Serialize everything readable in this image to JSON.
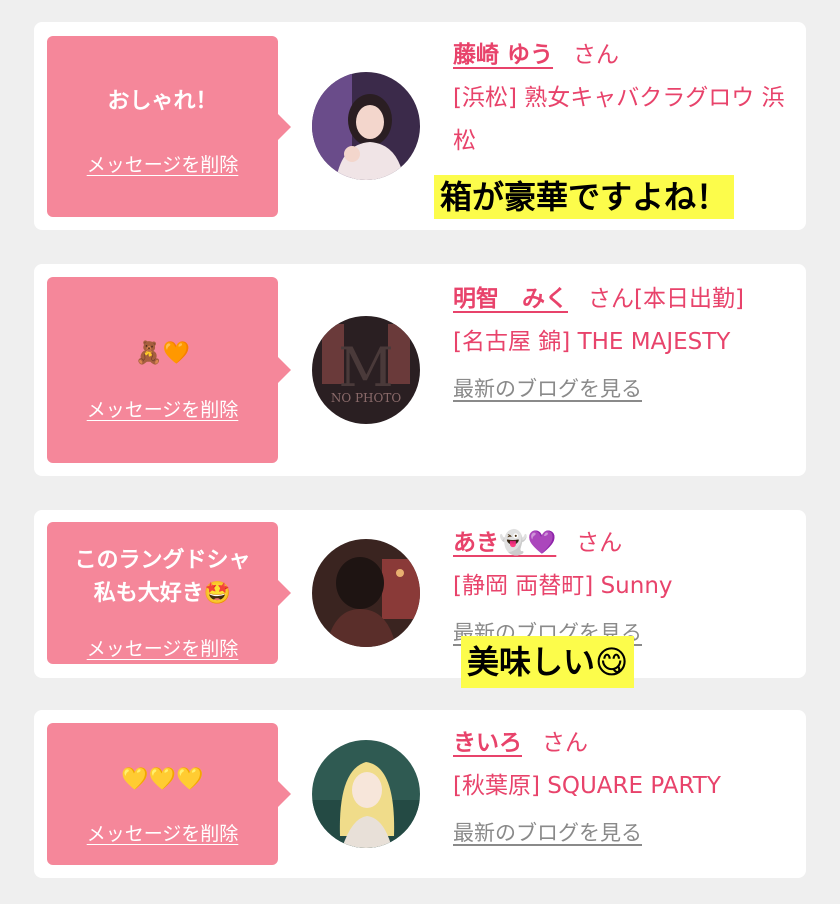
{
  "colors": {
    "background": "#efefef",
    "card": "#ffffff",
    "bubble": "#f5879a",
    "accent": "#e8436b",
    "link_gray": "#8a8a8a",
    "highlight": "#fcfc4b"
  },
  "items": [
    {
      "message": "おしゃれ！",
      "delete_label": "メッセージを削除",
      "name": "藤崎 ゆう",
      "suffix": "さん",
      "shop": "[浜松] 熟女キャバクラグロウ 浜松",
      "blog_label": "",
      "avatar_icon": "woman-portrait-photo"
    },
    {
      "message": "🧸🧡",
      "delete_label": "メッセージを削除",
      "name": "明智　みく",
      "suffix": "さん[本日出勤]",
      "shop": "[名古屋 錦] THE MAJESTY",
      "blog_label": "最新のブログを見る",
      "avatar_icon": "no-photo-placeholder"
    },
    {
      "message": "このラングドシャ私も大好き🤩",
      "delete_label": "メッセージを削除",
      "name": "あき👻💜",
      "suffix": "さん",
      "shop": "[静岡 両替町] Sunny",
      "blog_label": "最新のブログを見る",
      "avatar_icon": "woman-back-photo"
    },
    {
      "message": "💛💛💛",
      "delete_label": "メッセージを削除",
      "name": "きいろ",
      "suffix": "さん",
      "shop": "[秋葉原] SQUARE PARTY",
      "blog_label": "最新のブログを見る",
      "avatar_icon": "blonde-woman-photo"
    }
  ],
  "captions": [
    "箱が豪華ですよね！",
    "美味しい😋"
  ],
  "avatar_watermark": "NO PHOTO"
}
